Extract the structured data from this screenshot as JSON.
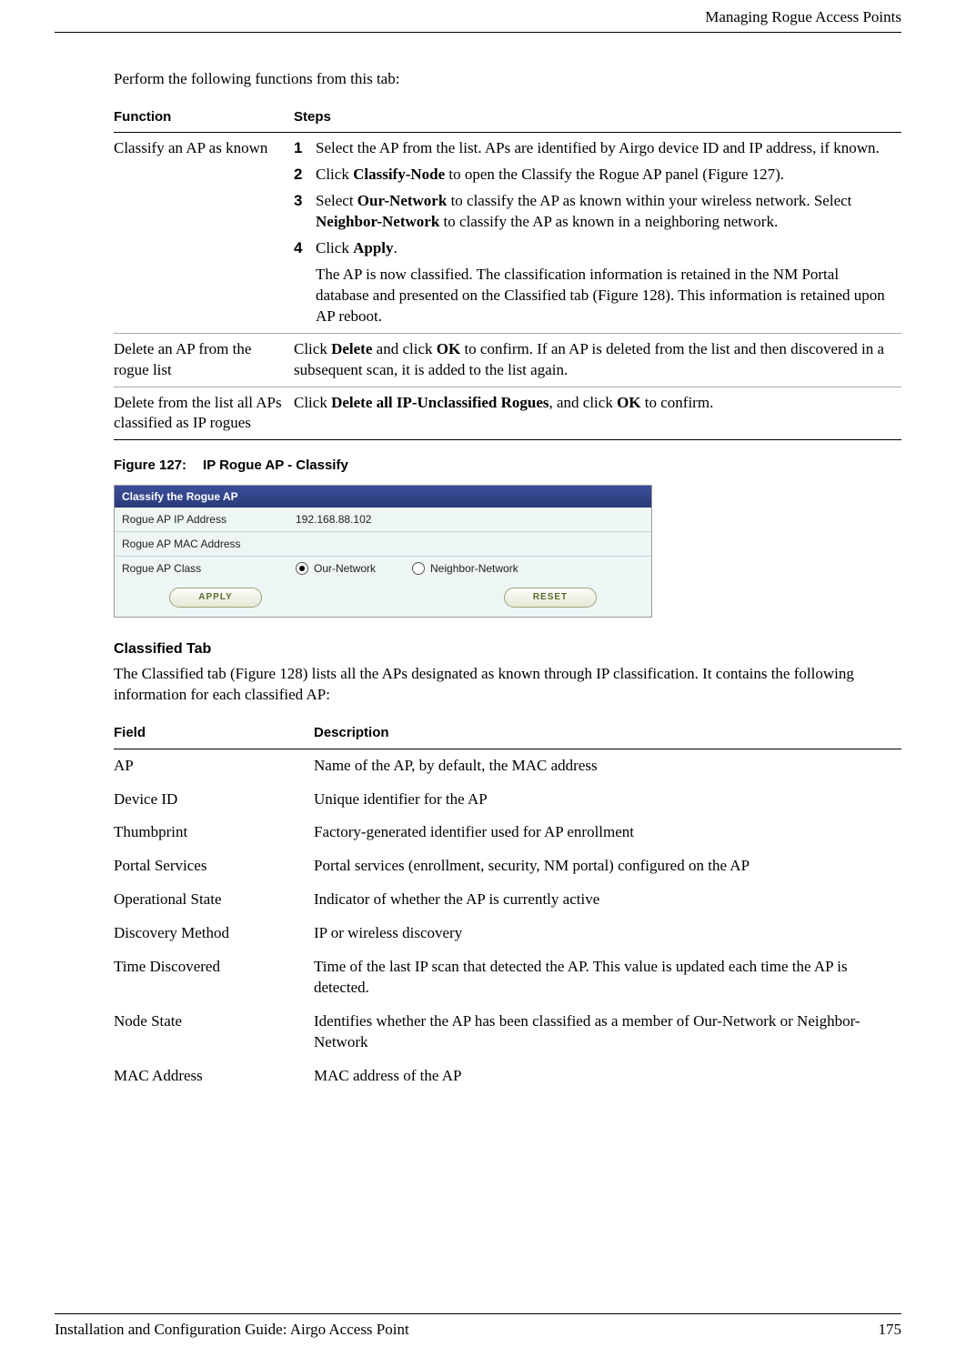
{
  "header": {
    "running_head": "Managing Rogue Access Points"
  },
  "intro": "Perform the following functions from this tab:",
  "func_table": {
    "headers": {
      "function": "Function",
      "steps": "Steps"
    },
    "rows": [
      {
        "function": "Classify an AP as known",
        "steps": [
          {
            "n": "1",
            "text_pre": "Select the AP from the list. APs are identified by Airgo device ID and IP address, if known."
          },
          {
            "n": "2",
            "text_pre": "Click ",
            "bold1": "Classify-Node",
            "text_post": " to open the Classify the Rogue AP panel (Figure 127)."
          },
          {
            "n": "3",
            "text_pre": "Select ",
            "bold1": "Our-Network",
            "mid1": " to classify the AP as known within your wireless network. Select ",
            "bold2": "Neighbor-Network",
            "text_post": " to classify the AP as known in a neighboring network."
          },
          {
            "n": "4",
            "text_pre": "Click ",
            "bold1": "Apply",
            "text_post": "."
          }
        ],
        "note": "The AP is now classified. The classification information is retained in the NM Portal database and presented on the Classified tab (Figure 128). This information is retained upon AP reboot."
      },
      {
        "function": "Delete an AP from the rogue list",
        "plain_pre": "Click ",
        "b1": "Delete",
        "mid1": " and click ",
        "b2": "OK",
        "plain_post": " to confirm. If an AP is deleted from the list and then discovered in a subsequent scan, it is added to the list again."
      },
      {
        "function": "Delete from the list all APs classified as IP rogues",
        "plain_pre": "Click ",
        "b1": "Delete all IP-Unclassified Rogues",
        "mid1": ", and click ",
        "b2": "OK",
        "plain_post": " to confirm."
      }
    ]
  },
  "figure127": {
    "caption_num": "Figure 127:",
    "caption_title": "IP Rogue AP - Classify",
    "panel_title": "Classify the Rogue AP",
    "rows": {
      "ip_label": "Rogue AP IP Address",
      "ip_value": "192.168.88.102",
      "mac_label": "Rogue AP MAC Address",
      "mac_value": "",
      "class_label": "Rogue AP Class",
      "opt1": "Our-Network",
      "opt2": "Neighbor-Network"
    },
    "buttons": {
      "apply": "APPLY",
      "reset": "RESET"
    }
  },
  "classified_section": {
    "heading": "Classified Tab",
    "para": "The Classified tab (Figure 128) lists all the APs designated as known through IP classification. It contains the following information for each classified AP:"
  },
  "field_table": {
    "headers": {
      "field": "Field",
      "description": "Description"
    },
    "rows": [
      {
        "field": "AP",
        "desc": "Name of the AP, by default, the MAC address"
      },
      {
        "field": "Device ID",
        "desc": "Unique identifier for the AP"
      },
      {
        "field": "Thumbprint",
        "desc": "Factory-generated identifier used for AP enrollment"
      },
      {
        "field": "Portal Services",
        "desc": "Portal services (enrollment, security, NM portal) configured on the AP"
      },
      {
        "field": "Operational State",
        "desc": "Indicator of whether the AP is currently active"
      },
      {
        "field": "Discovery Method",
        "desc": "IP or wireless discovery"
      },
      {
        "field": "Time Discovered",
        "desc": "Time of the last IP scan that detected the AP. This value is updated each time the AP is detected."
      },
      {
        "field": "Node State",
        "desc": "Identifies whether the AP has been classified as a member of Our-Network or Neighbor-Network"
      },
      {
        "field": "MAC Address",
        "desc": "MAC address of the AP"
      }
    ]
  },
  "footer": {
    "doc_title": "Installation and Configuration Guide: Airgo Access Point",
    "page_number": "175"
  }
}
